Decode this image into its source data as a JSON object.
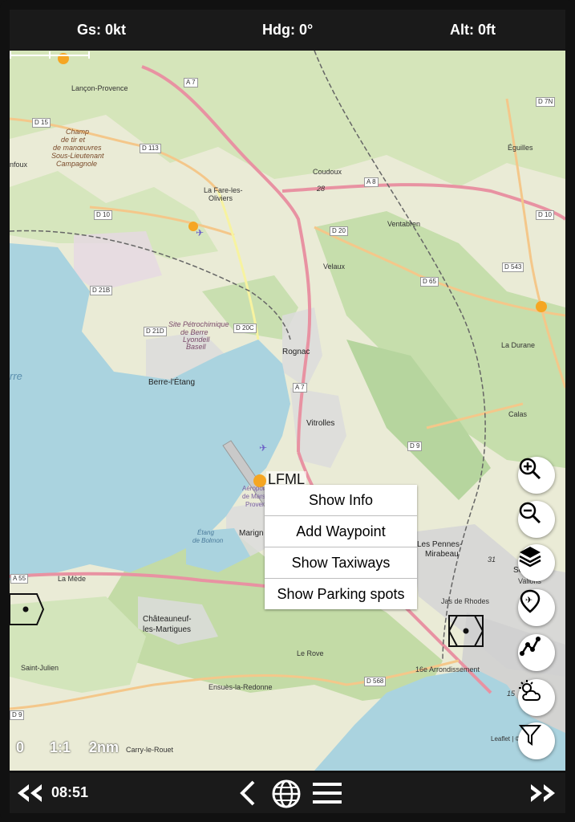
{
  "topbar": {
    "groundspeed": "Gs: 0kt",
    "heading": "Hdg: 0°",
    "altitude": "Alt: 0ft"
  },
  "map": {
    "places": {
      "lancon": "Lançon-Provence",
      "camp": "Champ de tir et de manœuvres Sous-Lieutenant Campagnole",
      "camp_l1": "Champ",
      "camp_l2": "de tir et",
      "camp_l3": "de manœuvres",
      "camp_l4": "Sous-Lieutenant",
      "camp_l5": "Campagnole",
      "fonfoux": "nfoux",
      "coudoux": "Coudoux",
      "lafare1": "La Fare-les-",
      "lafare2": "Oliviers",
      "ventabren": "Ventabren",
      "velaux": "Velaux",
      "eguilles": "Éguilles",
      "rognac": "Rognac",
      "berre": "Berre-l'Étang",
      "site1": "Site Pétrochimique",
      "site2": "de Berre",
      "site3": "Lyondell",
      "site4": "Basell",
      "ladurane": "La Durane",
      "vitrolles": "Vitrolles",
      "calas": "Calas",
      "marignane": "Marign",
      "airport1": "Aéroport",
      "airport2": "de Mars",
      "airport3": "Proven",
      "etang1": "Étang",
      "etang2": "de Bolmon",
      "lesPennes1": "Les Pennes-",
      "lesPennes2": "Mirabeau",
      "septemes1": "Se",
      "septemes2": "Vallons",
      "lamede": "La Mède",
      "jas": "Jas de Rhodes",
      "chateau1": "Châteauneuf-",
      "chateau2": "les-Martigues",
      "saintjulien": "Saint-Julien",
      "lerove": "Le Rove",
      "arr16": "16e Arrondissement",
      "ensues": "Ensuès-la-Redonne",
      "carry": "Carry-le-Rouet",
      "leaflet": "Leaflet | ©",
      "berre_water": "rre",
      "airport_code": "LFML"
    },
    "roads": {
      "a7a": "A 7",
      "a7b": "A 7",
      "a8": "A 8",
      "d15": "D 15",
      "d113": "D 113",
      "d10a": "D 10",
      "d10b": "D 10",
      "d7n": "D 7N",
      "d20": "D 20",
      "d543": "D 543",
      "d21b": "D 21B",
      "d21d": "D 21D",
      "d20c": "D 20C",
      "d65": "D 65",
      "d9a": "D 9",
      "d9b": "D 9",
      "a55": "A 55",
      "d568": "D 568",
      "n28": "28",
      "n15": "15",
      "n31": "31"
    },
    "scale": {
      "zero": "0",
      "ratio": "1:1",
      "distance": "2nm"
    }
  },
  "context_menu": [
    "Show Info",
    "Add Waypoint",
    "Show Taxiways",
    "Show Parking spots"
  ],
  "map_controls": [
    "zoom-in-icon",
    "zoom-out-icon",
    "layers-icon",
    "airport-pin-icon",
    "route-icon",
    "weather-icon",
    "filter-icon"
  ],
  "bottombar": {
    "time": "08:51"
  },
  "colors": {
    "bar": "#1a1a1a",
    "water": "#aad3df",
    "land": "#e9ead4",
    "forest": "#add19e",
    "airport": "#f5a623"
  }
}
